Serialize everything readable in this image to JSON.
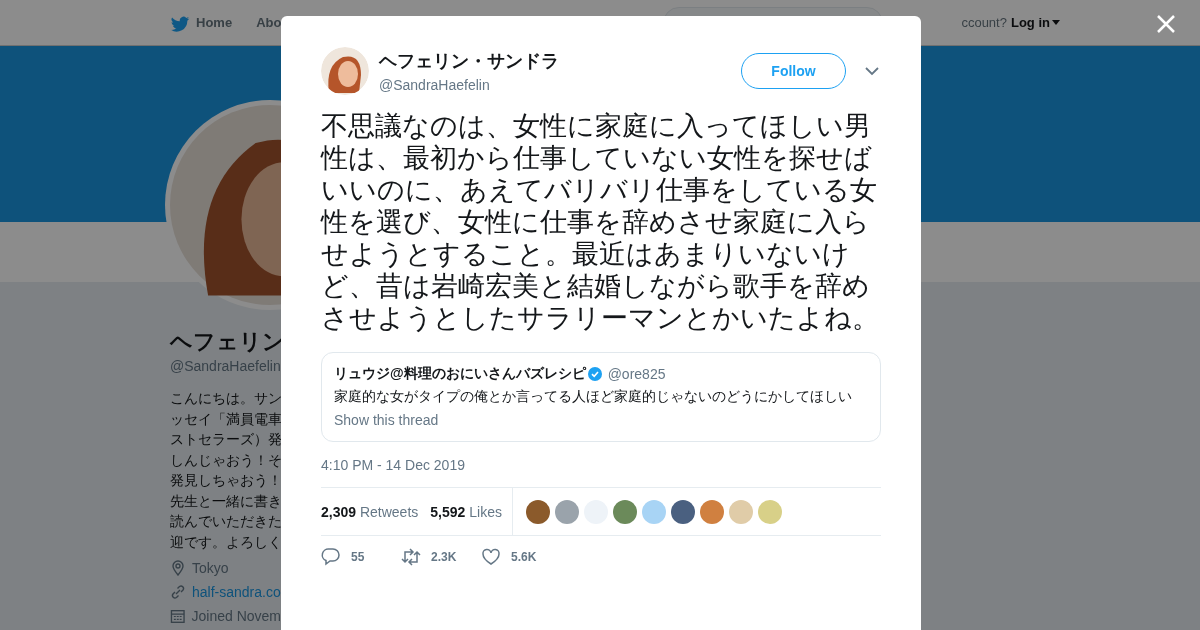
{
  "nav": {
    "items": [
      {
        "label": "Home",
        "kind": "home"
      },
      {
        "label": "Abo",
        "kind": "plain"
      }
    ],
    "account_prompt": "ccount?",
    "login": "Log in"
  },
  "profile": {
    "name": "ヘフェリン",
    "handle": "@SandraHaefelin",
    "bio_lines": [
      "こんにちは。サン",
      "ッセイ「満員電車",
      "ストセラーズ）発",
      "しんじゃおう！そ",
      "発見しちゃおう！",
      "先生と一緒に書き",
      "読んでいただきた",
      "迎です。よろしく"
    ],
    "location": "Tokyo",
    "url": "half-sandra.co",
    "joined": "Joined Novem"
  },
  "tweet": {
    "author": "ヘフェリン・サンドラ",
    "handle": "@SandraHaefelin",
    "follow": "Follow",
    "text": "不思議なのは、女性に家庭に入ってほしい男性は、最初から仕事していない女性を探せばいいのに、あえてバリバリ仕事をしている女性を選び、女性に仕事を辞めさせ家庭に入らせようとすること。最近はあまりいないけど、昔は岩崎宏美と結婚しながら歌手を辞めさせようとしたサラリーマンとかいたよね。",
    "quoted": {
      "author": "リュウジ@料理のおにいさんバズレシピ",
      "verified": true,
      "handle": "@ore825",
      "text": "家庭的な女がタイプの俺とか言ってる人ほど家庭的じゃないのどうにかしてほしい",
      "link": "Show this thread"
    },
    "time": "4:10 PM - 14 Dec 2019",
    "stats": [
      {
        "count": "2,309",
        "label": "Retweets"
      },
      {
        "count": "5,592",
        "label": "Likes"
      }
    ],
    "likers": [
      {
        "color": "#8b5a2b"
      },
      {
        "color": "#9aa3ab"
      },
      {
        "color": "#eef3f8"
      },
      {
        "color": "#6b8a5a"
      },
      {
        "color": "#a8d4f5"
      },
      {
        "color": "#4a6080"
      },
      {
        "color": "#d08040"
      },
      {
        "color": "#e0cca8"
      },
      {
        "color": "#d8d088"
      }
    ],
    "actions": [
      {
        "kind": "reply",
        "count": "55"
      },
      {
        "kind": "retweet",
        "count": "2.3K"
      },
      {
        "kind": "like",
        "count": "5.6K"
      }
    ]
  }
}
